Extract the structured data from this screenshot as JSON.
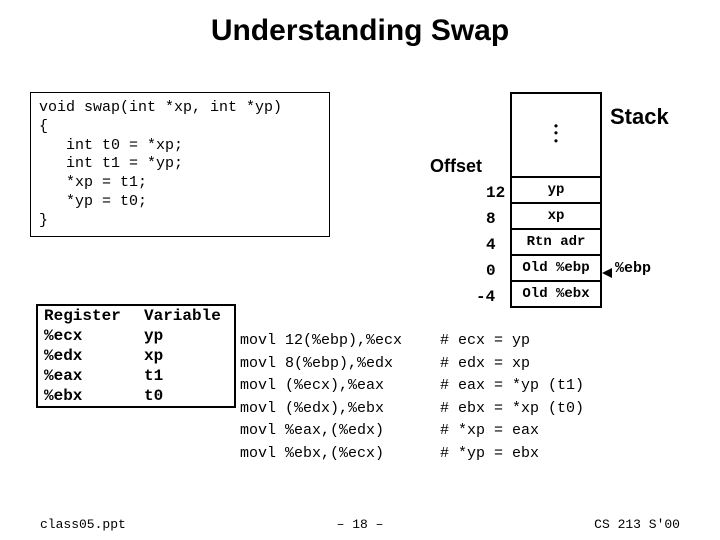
{
  "title": "Understanding Swap",
  "code": "void swap(int *xp, int *yp)\n{\n   int t0 = *xp;\n   int t1 = *yp;\n   *xp = t1;\n   *yp = t0;\n}",
  "stack": {
    "label": "Stack",
    "offset_label": "Offset",
    "rows": [
      {
        "offset": "12",
        "value": "yp"
      },
      {
        "offset": "8",
        "value": "xp"
      },
      {
        "offset": "4",
        "value": "Rtn adr"
      },
      {
        "offset": "0",
        "value": "Old %ebp"
      },
      {
        "offset": "-4",
        "value": "Old %ebx"
      }
    ],
    "ebp_label": "%ebp"
  },
  "reg_table": {
    "header": {
      "c1": "Register",
      "c2": "Variable"
    },
    "rows": [
      {
        "reg": "%ecx",
        "var": "yp"
      },
      {
        "reg": "%edx",
        "var": "xp"
      },
      {
        "reg": "%eax",
        "var": "t1"
      },
      {
        "reg": "%ebx",
        "var": "t0"
      }
    ]
  },
  "asm": [
    {
      "instr": "movl 12(%ebp),%ecx",
      "comment": "# ecx = yp"
    },
    {
      "instr": "movl 8(%ebp),%edx",
      "comment": "# edx = xp"
    },
    {
      "instr": "movl (%ecx),%eax",
      "comment": "# eax = *yp (t1)"
    },
    {
      "instr": "movl (%edx),%ebx",
      "comment": "# ebx = *xp (t0)"
    },
    {
      "instr": "movl %eax,(%edx)",
      "comment": "# *xp = eax"
    },
    {
      "instr": "movl %ebx,(%ecx)",
      "comment": "# *yp = ebx"
    }
  ],
  "footer": {
    "left": "class05.ppt",
    "mid": "– 18 –",
    "right": "CS 213 S'00"
  }
}
